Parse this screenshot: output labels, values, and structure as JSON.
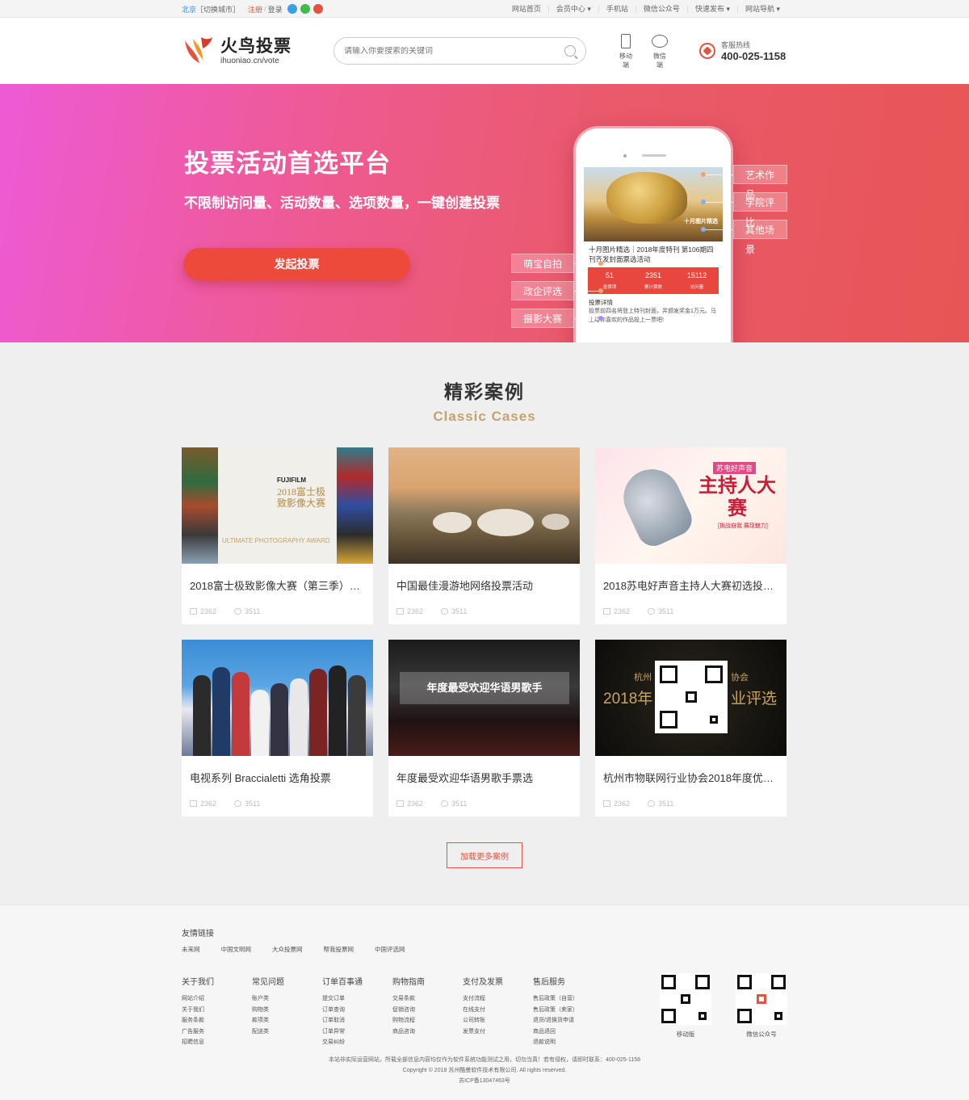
{
  "topbar": {
    "city": "北京",
    "switch_city": "［切换城市］",
    "register": "注册",
    "slash": "/",
    "login": "登录",
    "links": [
      "网站首页",
      "会员中心 ▾",
      "手机站",
      "微信公众号",
      "快速发布 ▾",
      "网站导航 ▾"
    ]
  },
  "header": {
    "logo_name": "火鸟投票",
    "logo_url": "ihuoniao.cn/vote",
    "search_placeholder": "请输入你要搜索的关键词",
    "mobile_label": "移动端",
    "wechat_label": "微信端",
    "hotline_label": "客服热线",
    "hotline_number": "400-025-1158"
  },
  "banner": {
    "title": "投票活动首选平台",
    "subtitle": "不限制访问量、活动数量、选项数量，一键创建投票",
    "button": "发起投票",
    "tags_right": [
      "艺术作品",
      "学院评比",
      "其他场景"
    ],
    "tags_left": [
      "萌宝自拍",
      "政企评选",
      "摄影大赛"
    ],
    "phone": {
      "image_caption": "十月图片精选",
      "headline": "十月图片精选｜2018年度特刊 第106期四刊齐发封面票选活动",
      "stats": [
        {
          "value": "51",
          "label": "投票项"
        },
        {
          "value": "2351",
          "label": "累计票数"
        },
        {
          "value": "15112",
          "label": "访问量"
        }
      ],
      "detail_title": "投票详情",
      "detail_text": "投票前四名将登上特刊封面，并颁发奖金1万元。马上给你喜欢的作品投上一票吧!"
    }
  },
  "cases": {
    "title": "精彩案例",
    "subtitle": "Classic Cases",
    "items": [
      {
        "title": "2018富士极致影像大赛（第三季）第...",
        "votes": "2362",
        "views": "3511",
        "image": "fuji"
      },
      {
        "title": "中国最佳漫游地网络投票活动",
        "votes": "2362",
        "views": "3511",
        "image": "sheep"
      },
      {
        "title": "2018苏电好声音主持人大赛初选投票...",
        "votes": "2362",
        "views": "3511",
        "image": "host"
      },
      {
        "title": "电视系列 Braccialetti 选角投票",
        "votes": "2362",
        "views": "3511",
        "image": "tv"
      },
      {
        "title": "年度最受欢迎华语男歌手票选",
        "votes": "2362",
        "views": "3511",
        "image": "singer"
      },
      {
        "title": "杭州市物联网行业协会2018年度优秀...",
        "votes": "2362",
        "views": "3511",
        "image": "iot"
      }
    ],
    "fuji": {
      "brand": "FUJIFILM",
      "cn": "2018富士极致影像大赛",
      "en": "ULTIMATE PHOTOGRAPHY AWARD"
    },
    "host": {
      "badge": "苏电好声音",
      "title": "主持人大赛",
      "tagline": "[挑战自我 展现魅力]"
    },
    "singer": {
      "banner": "年度最受欢迎华语男歌手"
    },
    "iot": {
      "l1": "杭州",
      "l2": "2018年",
      "r1": "协会",
      "r2": "业评选"
    },
    "more": "加载更多案例"
  },
  "footer": {
    "links_title": "友情链接",
    "links": [
      "未来网",
      "中国文明网",
      "大众投票网",
      "帮我投票网",
      "中国评选网"
    ],
    "columns": [
      {
        "title": "关于我们",
        "items": [
          "网站介绍",
          "关于我们",
          "服务条款",
          "广告服务",
          "招聘信息"
        ]
      },
      {
        "title": "常见问题",
        "items": [
          "账户类",
          "购物类",
          "款项类",
          "配送类"
        ]
      },
      {
        "title": "订单百事通",
        "items": [
          "提交订单",
          "订单查询",
          "订单取消",
          "订单异常",
          "交易纠纷"
        ]
      },
      {
        "title": "购物指南",
        "items": [
          "交易条款",
          "促销咨询",
          "购物流程",
          "商品咨询"
        ]
      },
      {
        "title": "支付及发票",
        "items": [
          "支付流程",
          "在线支付",
          "公司转账",
          "发票支付"
        ]
      },
      {
        "title": "售后服务",
        "items": [
          "售后政策（自营）",
          "售后政策（卖家）",
          "退货/退换货申请",
          "商品退回",
          "退款说明"
        ]
      }
    ],
    "qr_mobile": "移动版",
    "qr_wechat": "微信公众号",
    "copy1": "本站非实际运营网站，所载全部信息内容均仅作为软件系统功能测试之用，切勿当真！若有侵权，请即时联系：400-025-1158",
    "copy2": "Copyright © 2018 苏州酷曼软件技术有限公司. All rights reserved.",
    "icp": "苏ICP备13047463号"
  }
}
